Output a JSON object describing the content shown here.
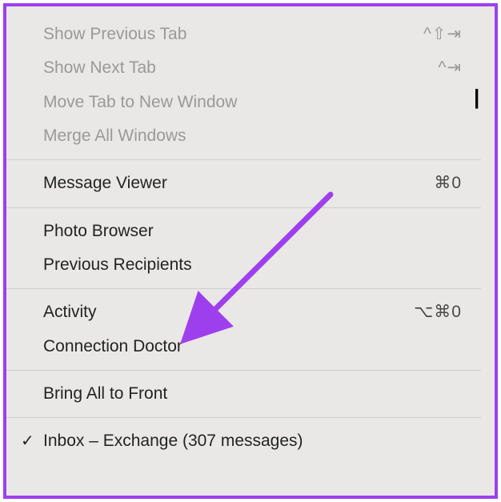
{
  "menu": {
    "items": [
      {
        "label": "Show Previous Tab",
        "shortcut": "^⇧⇥",
        "enabled": false
      },
      {
        "label": "Show Next Tab",
        "shortcut": "^⇥",
        "enabled": false
      },
      {
        "label": "Move Tab to New Window",
        "shortcut": "",
        "enabled": false
      },
      {
        "label": "Merge All Windows",
        "shortcut": "",
        "enabled": false
      }
    ],
    "group2": [
      {
        "label": "Message Viewer",
        "shortcut": "⌘0"
      }
    ],
    "group3": [
      {
        "label": "Photo Browser",
        "shortcut": ""
      },
      {
        "label": "Previous Recipients",
        "shortcut": ""
      }
    ],
    "group4": [
      {
        "label": "Activity",
        "shortcut": "⌥⌘0"
      },
      {
        "label": "Connection Doctor",
        "shortcut": ""
      }
    ],
    "group5": [
      {
        "label": "Bring All to Front",
        "shortcut": ""
      }
    ],
    "group6": [
      {
        "label": "Inbox – Exchange (307 messages)",
        "shortcut": "",
        "checked": true
      }
    ]
  },
  "annotation": {
    "type": "arrow",
    "color": "#9e3fee"
  }
}
